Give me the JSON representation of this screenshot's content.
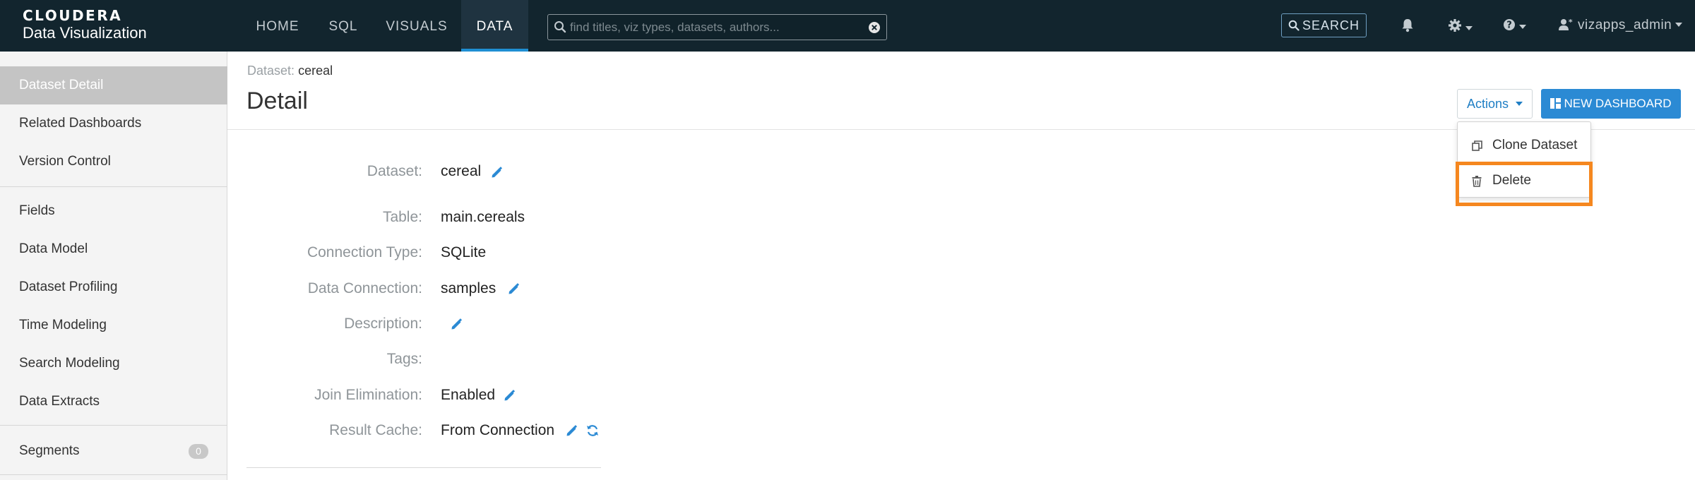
{
  "brand": {
    "line1": "CLOUDERA",
    "line2": "Data Visualization"
  },
  "nav": {
    "tabs": [
      {
        "label": "HOME"
      },
      {
        "label": "SQL"
      },
      {
        "label": "VISUALS"
      },
      {
        "label": "DATA"
      }
    ],
    "active_tab": "DATA",
    "search_placeholder": "find titles, viz types, datasets, authors...",
    "search_button": "SEARCH",
    "user": "vizapps_admin"
  },
  "sidebar": {
    "items": [
      {
        "label": "Dataset Detail"
      },
      {
        "label": "Related Dashboards"
      },
      {
        "label": "Version Control"
      },
      {
        "label": "Fields"
      },
      {
        "label": "Data Model"
      },
      {
        "label": "Dataset Profiling"
      },
      {
        "label": "Time Modeling"
      },
      {
        "label": "Search Modeling"
      },
      {
        "label": "Data Extracts"
      },
      {
        "label": "Segments",
        "badge": "0"
      }
    ],
    "active_item": "Dataset Detail"
  },
  "breadcrumb": {
    "label": "Dataset:",
    "value": "cereal"
  },
  "page_title": "Detail",
  "actions": {
    "button": "Actions",
    "new_dashboard": "NEW DASHBOARD",
    "menu": [
      {
        "label": "Clone Dataset"
      },
      {
        "label": "Delete"
      }
    ],
    "highlighted_item": "Delete",
    "highlight_color": "#f5871f"
  },
  "fields": [
    {
      "label": "Dataset:",
      "value": "cereal"
    },
    {
      "label": "Table:",
      "value": "main.cereals"
    },
    {
      "label": "Connection Type:",
      "value": "SQLite"
    },
    {
      "label": "Data Connection:",
      "value": "samples"
    },
    {
      "label": "Description:",
      "value": ""
    },
    {
      "label": "Tags:",
      "value": ""
    },
    {
      "label": "Join Elimination:",
      "value": "Enabled"
    },
    {
      "label": "Result Cache:",
      "value": "From Connection"
    }
  ],
  "colors": {
    "topbar": "#12252e",
    "accent": "#2b8ad4",
    "link": "#1f7ec4",
    "highlight": "#f5871f"
  }
}
